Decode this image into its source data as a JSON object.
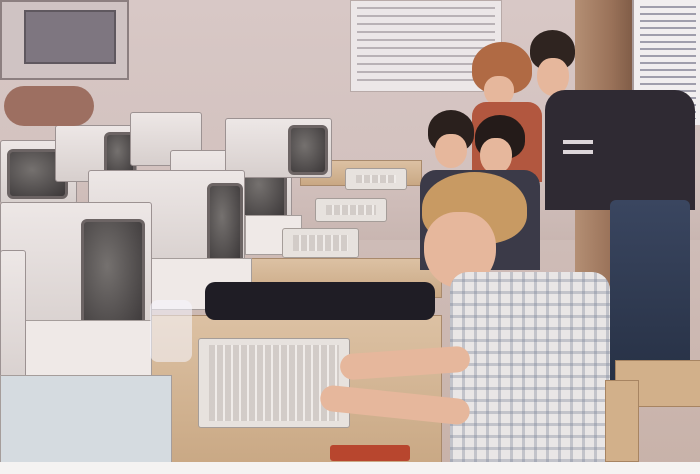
{
  "scene": {
    "subject": "",
    "palette": {
      "wall": "#d8c8c6",
      "desk": "#dcc1a3",
      "monitor": "#e9e3e2",
      "screen": "#4a4546",
      "sweater": "#2f2a33",
      "plaid_shirt": "#e9e6e6",
      "hair_blond": "#c89a63",
      "hair_dark": "#2f2420"
    }
  }
}
